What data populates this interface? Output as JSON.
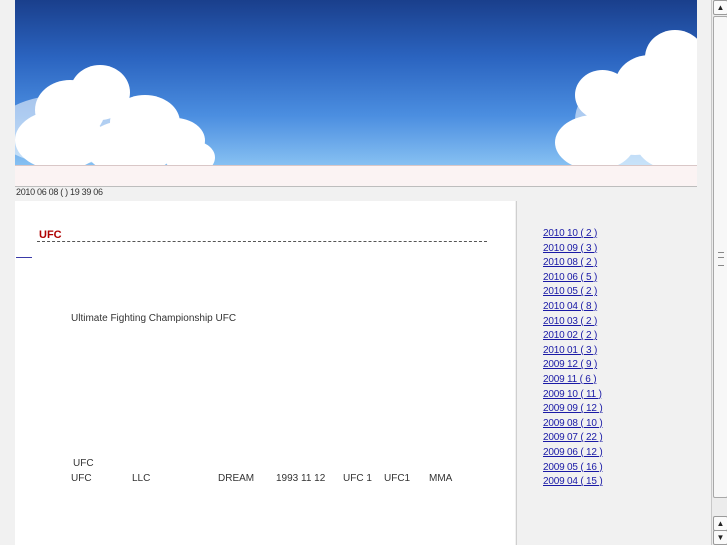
{
  "post": {
    "date": "2010 06 08 ( ) 19 39 06",
    "title": "UFC",
    "intro": "Ultimate Fighting Championship   UFC",
    "ufc_heading": "UFC",
    "facts": [
      "UFC",
      "LLC",
      "DREAM",
      "1993 11 12",
      "UFC  1",
      "UFC1",
      "MMA"
    ]
  },
  "archives": [
    "2010 10 ( 2 )",
    "2010 09 ( 3 )",
    "2010 08 ( 2 )",
    "2010 06 ( 5 )",
    "2010 05 ( 2 )",
    "2010 04 ( 8 )",
    "2010 03 ( 2 )",
    "2010 02 ( 2 )",
    "2010 01 ( 3 )",
    "2009 12 ( 9 )",
    "2009 11 ( 6 )",
    "2009 10 ( 11 )",
    "2009 09 ( 12 )",
    "2009 08 ( 10 )",
    "2009 07 ( 22 )",
    "2009 06 ( 12 )",
    "2009 05 ( 16 )",
    "2009 04 ( 15 )"
  ],
  "scrollbar": {
    "up_icon": "arrow-up-icon",
    "down_icon": "arrow-down-icon"
  }
}
